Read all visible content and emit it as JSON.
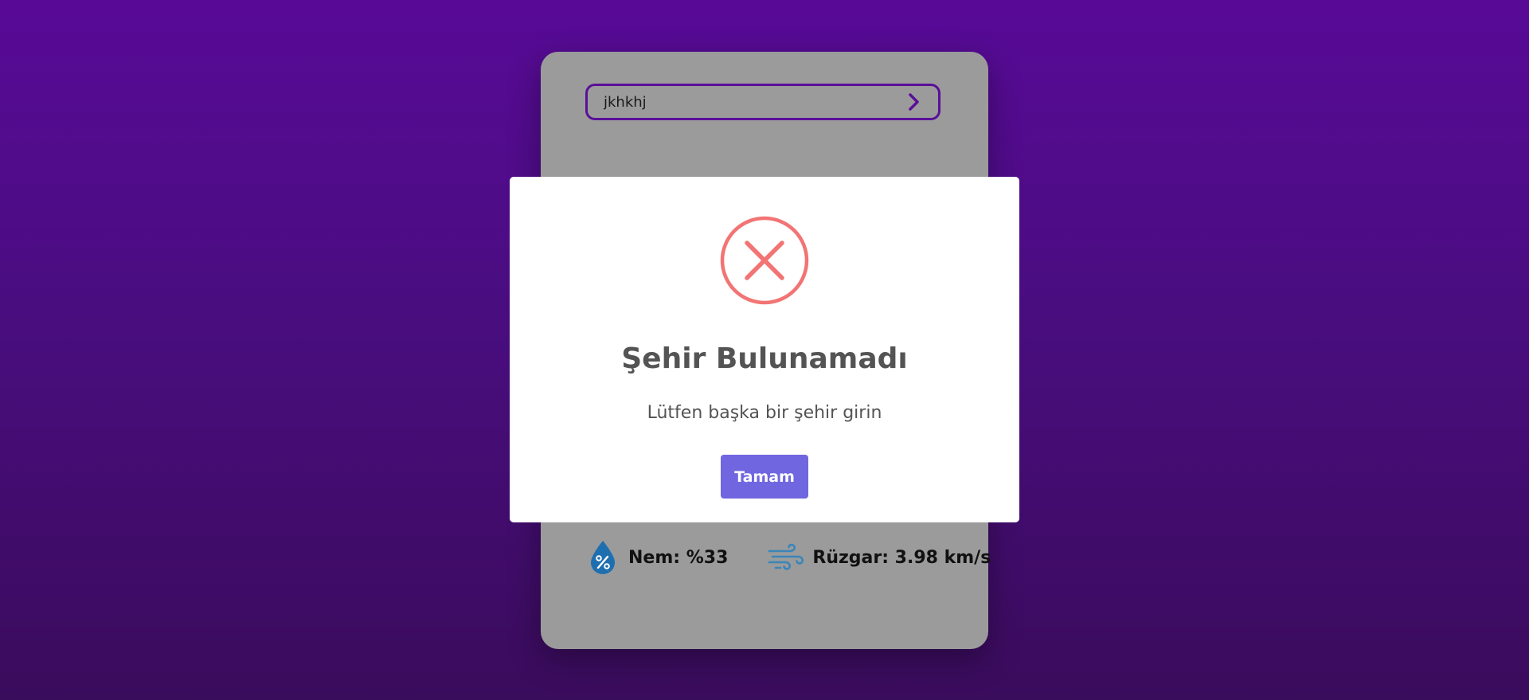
{
  "search": {
    "value": "jkhkhj",
    "button_icon": "chevron-right-icon"
  },
  "stats": {
    "humidity_label": "Nem: %33",
    "humidity_icon": "humidity-drop-icon",
    "wind_label": "Rüzgar: 3.98 km/s",
    "wind_icon": "wind-icon"
  },
  "modal": {
    "icon": "error-x-icon",
    "title": "Şehir Bulunamadı",
    "text": "Lütfen başka bir şehir girin",
    "confirm_label": "Tamam"
  },
  "colors": {
    "background_top": "#580a97",
    "background_bottom": "#3a0c5c",
    "card": "#9b9b9b",
    "accent": "#5a0f98",
    "error": "#f27474",
    "button": "#7066e0",
    "humidity_icon": "#1e6fb0",
    "wind_icon": "#3a86b8"
  }
}
